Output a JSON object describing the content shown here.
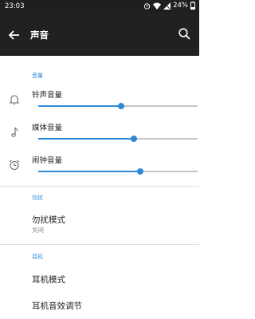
{
  "status_bar": {
    "time": "23:03",
    "battery": "24%"
  },
  "app_bar": {
    "title": "声音"
  },
  "volume_section": {
    "header": "音量",
    "items": [
      {
        "label": "铃声音量",
        "icon": "bell-icon",
        "level": 0.52
      },
      {
        "label": "媒体音量",
        "icon": "music-note-icon",
        "level": 0.6
      },
      {
        "label": "闹钟音量",
        "icon": "alarm-clock-icon",
        "level": 0.64
      }
    ]
  },
  "dnd_section": {
    "header": "勿扰",
    "item": {
      "title": "勿扰模式",
      "subtitle": "关闭"
    }
  },
  "earphone_section": {
    "header": "耳机",
    "items": [
      {
        "title": "耳机模式"
      },
      {
        "title": "耳机音效调节"
      }
    ]
  },
  "colors": {
    "accent": "#2e89d8",
    "app_bar": "#212121",
    "status_bar": "#1f1f1f"
  }
}
